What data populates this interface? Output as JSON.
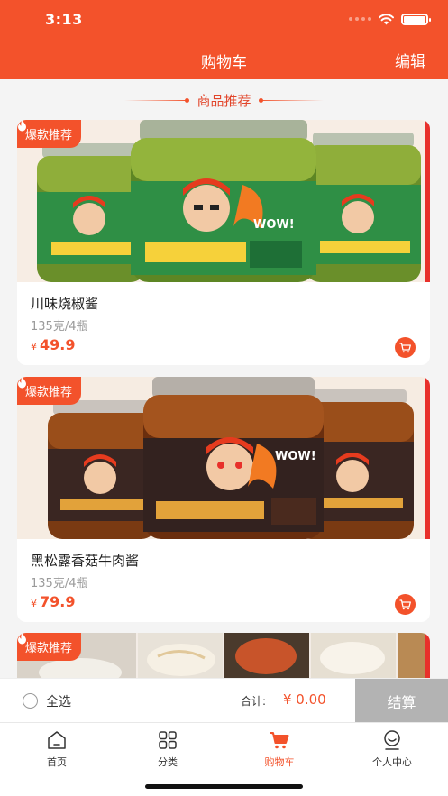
{
  "status_bar": {
    "time": "3:13"
  },
  "header": {
    "title": "购物车",
    "edit_label": "编辑"
  },
  "section": {
    "title": "商品推荐"
  },
  "products": [
    {
      "badge": "爆款推荐",
      "name": "川味烧椒酱",
      "spec": "135克/4瓶",
      "currency": "¥",
      "price": "49.9",
      "image_theme": "green-chili-jars"
    },
    {
      "badge": "爆款推荐",
      "name": "黑松露香菇牛肉酱",
      "spec": "135克/4瓶",
      "currency": "¥",
      "price": "79.9",
      "image_theme": "mushroom-beef-jars"
    },
    {
      "badge": "爆款推荐",
      "image_theme": "noodle-dishes"
    }
  ],
  "checkout": {
    "select_all_label": "全选",
    "total_label": "合计:",
    "total_value": "¥ 0.00",
    "settle_label": "结算"
  },
  "tabbar": {
    "items": [
      {
        "label": "首页",
        "icon": "home-icon"
      },
      {
        "label": "分类",
        "icon": "grid-icon"
      },
      {
        "label": "购物车",
        "icon": "cart-icon",
        "active": true
      },
      {
        "label": "个人中心",
        "icon": "user-icon"
      }
    ]
  },
  "colors": {
    "brand": "#f3522b",
    "price": "#f3522b",
    "settle_disabled": "#b3b3b3",
    "jar_green": "#2f8f45"
  }
}
